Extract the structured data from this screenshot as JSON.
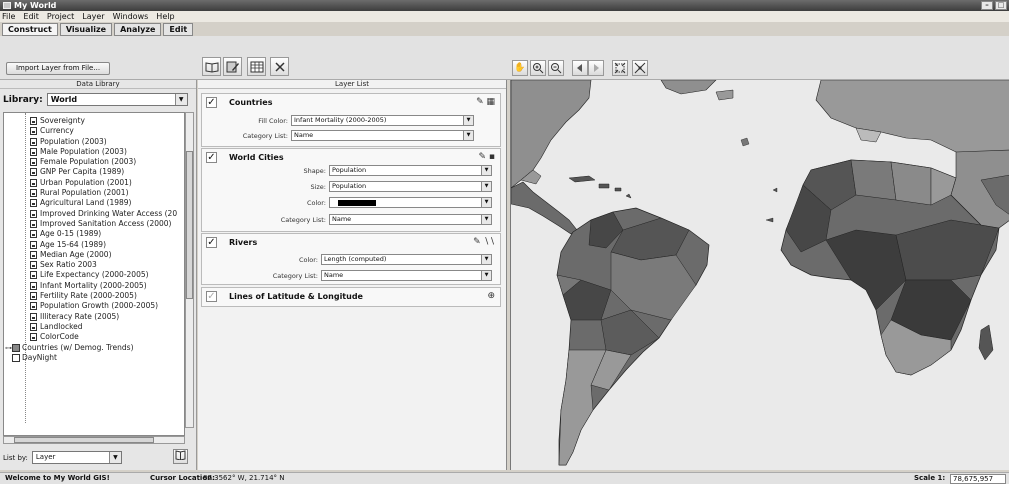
{
  "window": {
    "title": "My World"
  },
  "menus": [
    "File",
    "Edit",
    "Project",
    "Layer",
    "Windows",
    "Help"
  ],
  "tabs": [
    "Construct",
    "Visualize",
    "Analyze",
    "Edit"
  ],
  "toolbar": {
    "import_label": "Import Layer from File..."
  },
  "data_library": {
    "caption": "Data Library",
    "library_label": "Library:",
    "library_value": "World",
    "items": [
      "Sovereignty",
      "Currency",
      "Population (2003)",
      "Male Population (2003)",
      "Female Population (2003)",
      "GNP Per Capita (1989)",
      "Urban Population (2001)",
      "Rural Population (2001)",
      "Agricultural Land (1989)",
      "Improved Drinking Water Access (20",
      "Improved Sanitation Access (2000)",
      "Age 0-15 (1989)",
      "Age 15-64 (1989)",
      "Median Age (2000)",
      "Sex Ratio 2003",
      "Life Expectancy (2000-2005)",
      "Infant Mortality (2000-2005)",
      "Fertility Rate (2000-2005)",
      "Population Growth (2000-2005)",
      "Illiteracy Rate (2005)",
      "Landlocked",
      "ColorCode"
    ],
    "root_items": [
      "Countries (w/ Demog. Trends)",
      "DayNight"
    ],
    "list_by_label": "List by:",
    "list_by_value": "Layer"
  },
  "layer_list": {
    "caption": "Layer List",
    "layers": [
      {
        "name": "Countries",
        "checked": true,
        "props": [
          {
            "label": "Fill Color:",
            "value": "Infant Mortality (2000-2005)"
          },
          {
            "label": "Category List:",
            "value": "Name"
          }
        ]
      },
      {
        "name": "World Cities",
        "checked": true,
        "props": [
          {
            "label": "Shape:",
            "value": "Population"
          },
          {
            "label": "Size:",
            "value": "Population"
          },
          {
            "label": "Color:",
            "value": ""
          },
          {
            "label": "Category List:",
            "value": "Name"
          }
        ]
      },
      {
        "name": "Rivers",
        "checked": true,
        "props": [
          {
            "label": "Color:",
            "value": "Length (computed)"
          },
          {
            "label": "Category List:",
            "value": "Name"
          }
        ]
      },
      {
        "name": "Lines of Latitude & Longitude",
        "checked": false,
        "props": []
      }
    ]
  },
  "status": {
    "message": "Welcome to My World GIS!",
    "cursor_label": "Cursor Location:",
    "cursor_value": "87.3562° W, 21.714° N",
    "scale_label": "Scale 1:",
    "scale_value": "78,675,957"
  },
  "colors": {
    "country_dark": "#474747",
    "country_mid": "#6b6b6b",
    "country_light": "#999999",
    "ocean": "#eaeaea"
  }
}
